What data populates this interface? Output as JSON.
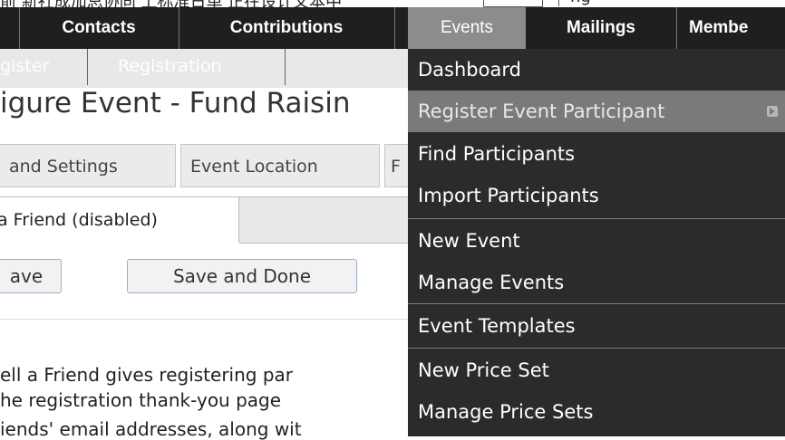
{
  "top_strip": {
    "text": "前   新社成加总协同 上标准日单  正在设计文本中",
    "tail": "ng"
  },
  "nav": {
    "items": [
      "Contacts",
      "Contributions",
      "Events",
      "Mailings",
      "Membe"
    ]
  },
  "breadcrumb": {
    "items": [
      "gister",
      "Registration"
    ]
  },
  "page_title": "igure Event - Fund Raisin",
  "tabs": {
    "row1": [
      "and Settings",
      "Event Location",
      "F"
    ],
    "row2_active": "a Friend (disabled)"
  },
  "buttons": {
    "save": "ave",
    "save_and_done": "Save and Done"
  },
  "description": [
    "ell a Friend gives registering par",
    "he registration thank-you page",
    "iends' email addresses, along wit"
  ],
  "events_menu": {
    "items": [
      {
        "label": "Dashboard"
      },
      {
        "label": "Register Event Participant",
        "highlighted": true,
        "has_submenu": true
      },
      {
        "label": "Find Participants"
      },
      {
        "label": "Import Participants"
      },
      {
        "label": "New Event"
      },
      {
        "label": "Manage Events"
      },
      {
        "label": "Event Templates"
      },
      {
        "label": "New Price Set"
      },
      {
        "label": "Manage Price Sets"
      }
    ]
  },
  "colors": {
    "navbar_bg": "#1f1f1f",
    "menu_bg": "#2b2b2b",
    "menu_highlight": "#7a7a7a",
    "active_nav_bg": "#8c8c8c"
  }
}
